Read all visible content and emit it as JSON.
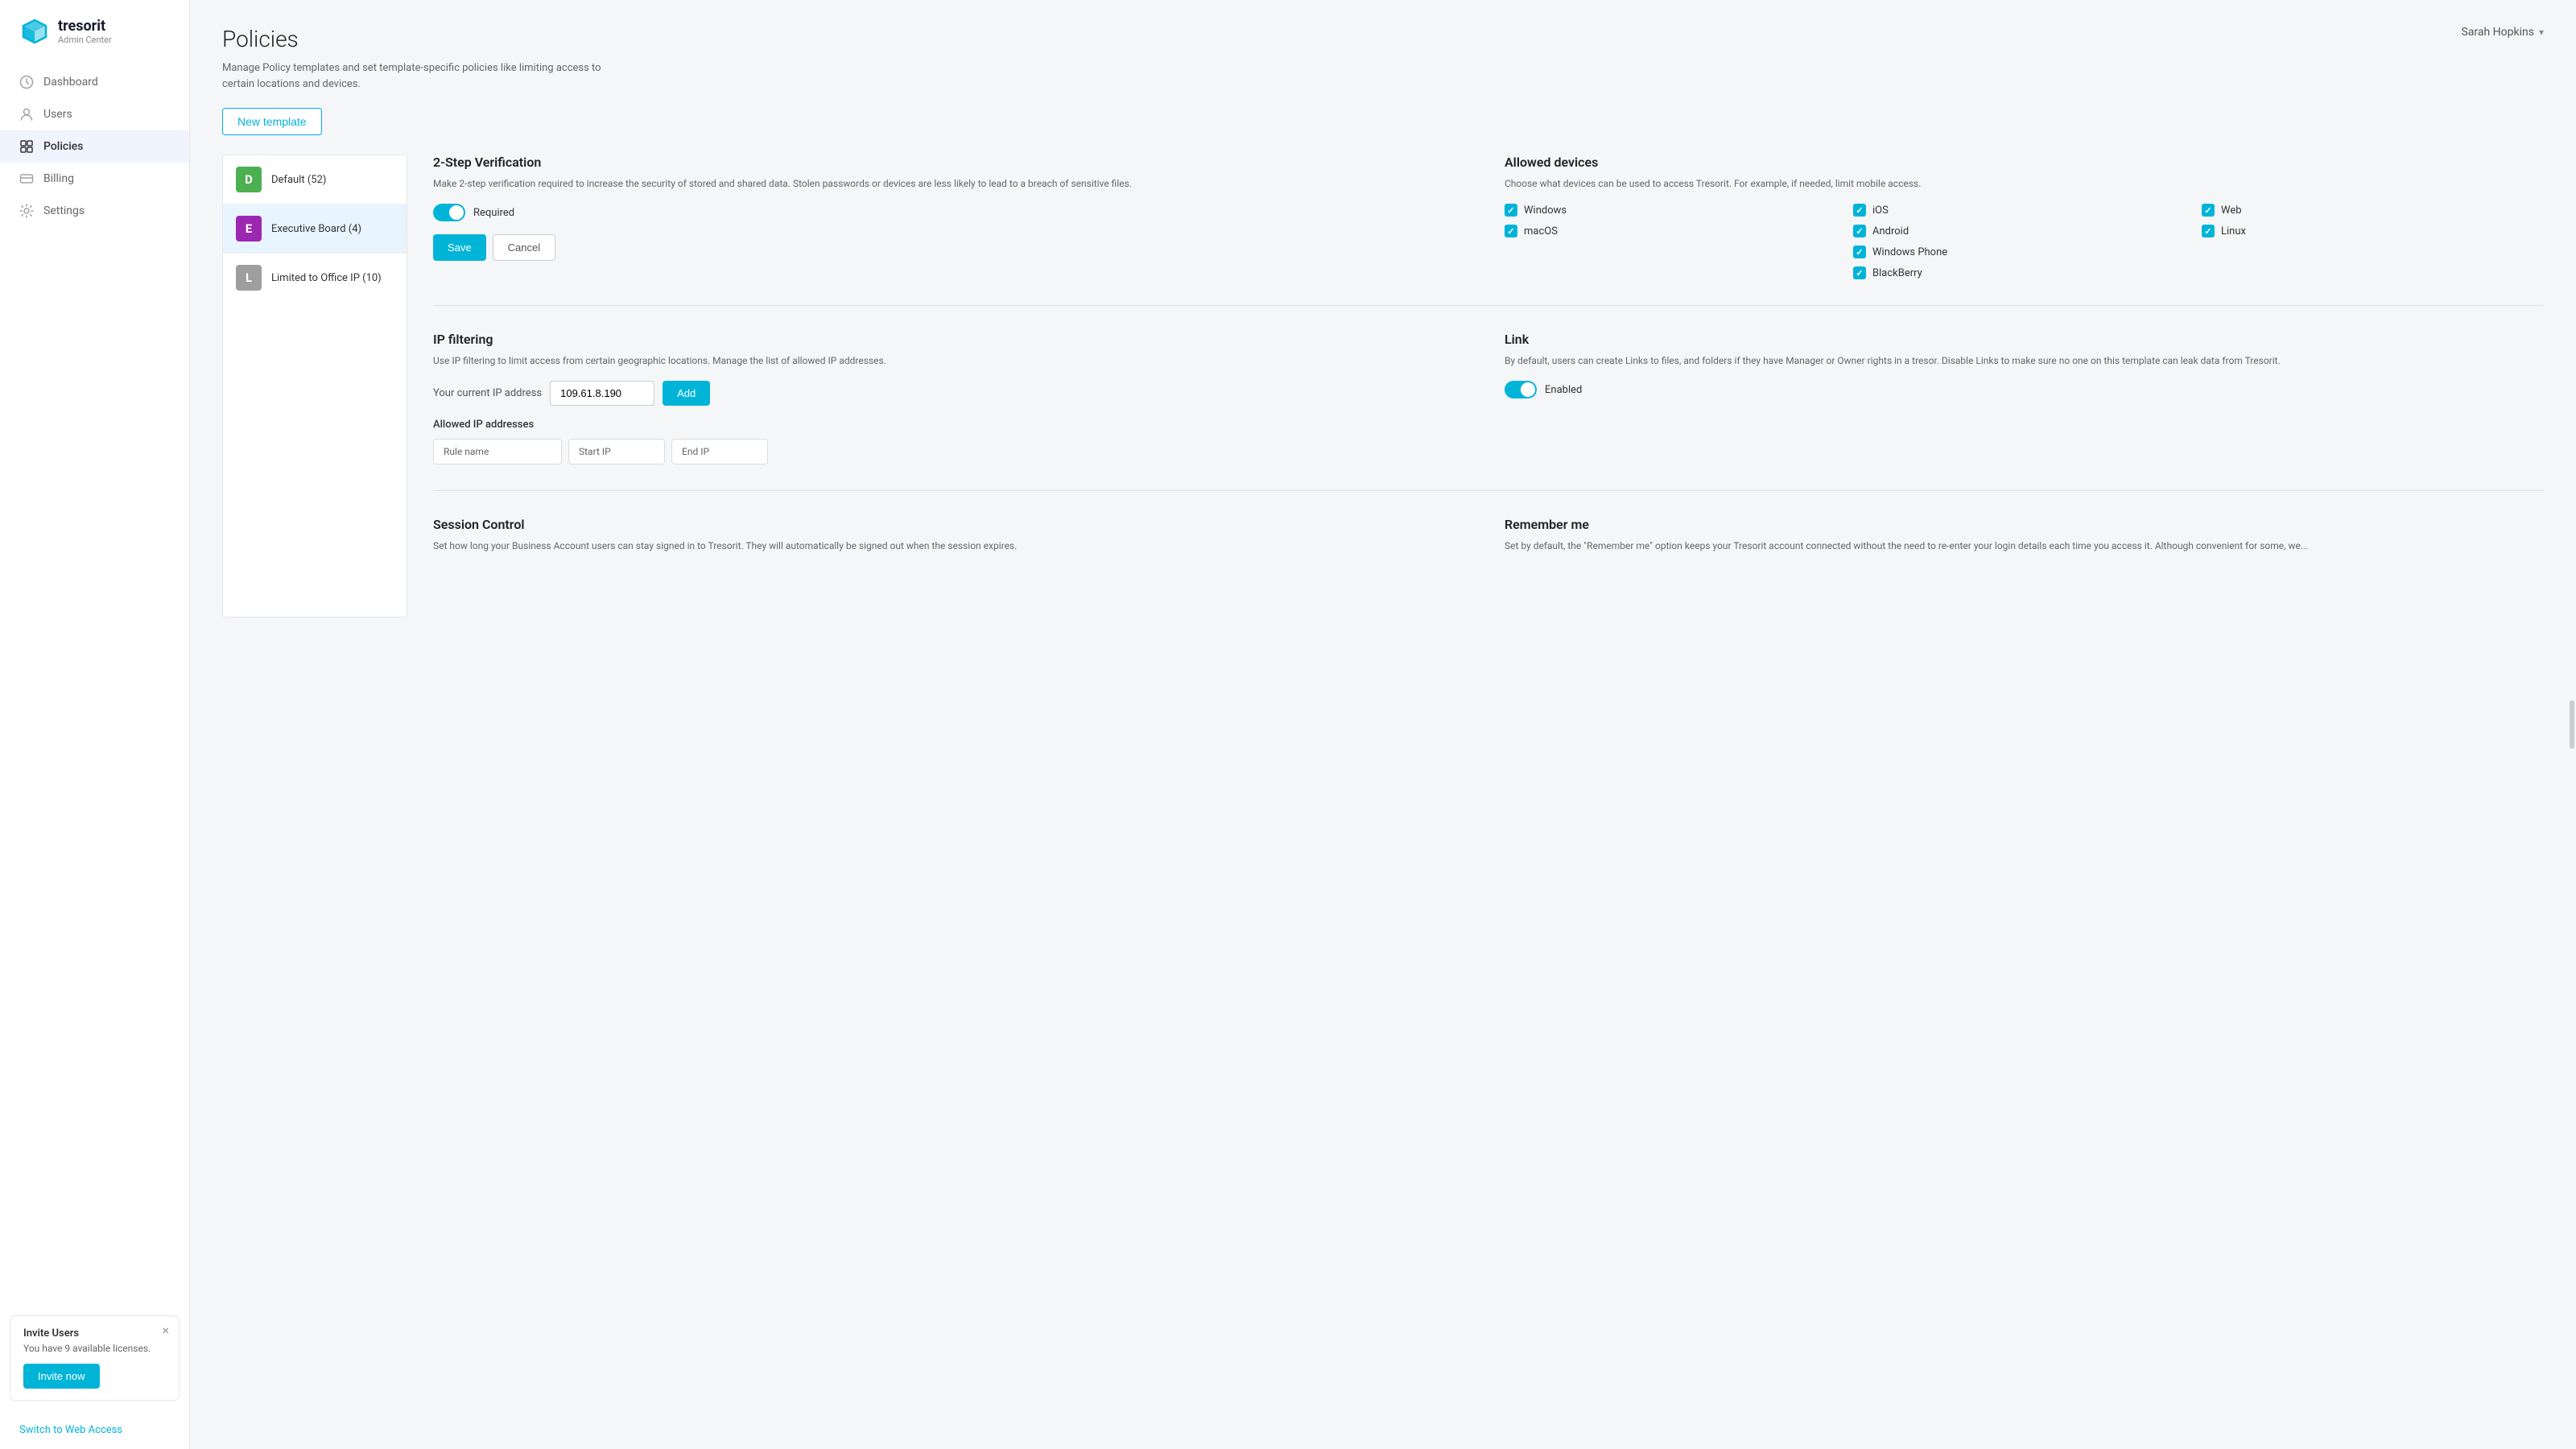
{
  "app": {
    "name": "tresorit",
    "admin_label": "Admin Center"
  },
  "user": {
    "name": "Sarah Hopkins"
  },
  "sidebar": {
    "nav_items": [
      {
        "id": "dashboard",
        "label": "Dashboard",
        "icon": "clock-icon",
        "active": false
      },
      {
        "id": "users",
        "label": "Users",
        "icon": "user-icon",
        "active": false
      },
      {
        "id": "policies",
        "label": "Policies",
        "icon": "grid-icon",
        "active": true
      },
      {
        "id": "billing",
        "label": "Billing",
        "icon": "card-icon",
        "active": false
      },
      {
        "id": "settings",
        "label": "Settings",
        "icon": "settings-icon",
        "active": false
      }
    ],
    "switch_web_access": "Switch to Web Access"
  },
  "invite_banner": {
    "title": "Invite Users",
    "description": "You have 9 available licenses.",
    "button_label": "Invite now"
  },
  "page": {
    "title": "Policies",
    "description": "Manage Policy templates and set template-specific policies like limiting access to certain locations and devices."
  },
  "new_template_button": "New template",
  "templates": [
    {
      "id": "default",
      "letter": "D",
      "name": "Default (52)",
      "color_class": "avatar-d"
    },
    {
      "id": "executive",
      "letter": "E",
      "name": "Executive Board (4)",
      "color_class": "avatar-e",
      "selected": true
    },
    {
      "id": "limited",
      "letter": "L",
      "name": "Limited to Office IP (10)",
      "color_class": "avatar-l"
    }
  ],
  "two_step": {
    "title": "2-Step Verification",
    "description": "Make 2-step verification required to increase the security of stored and shared data. Stolen passwords or devices are less likely to lead to a breach of sensitive files.",
    "toggle_label": "Required",
    "save_label": "Save",
    "cancel_label": "Cancel"
  },
  "allowed_devices": {
    "title": "Allowed devices",
    "description": "Choose what devices can be used to access Tresorit. For example, if needed, limit mobile access.",
    "devices": [
      {
        "label": "Windows",
        "checked": true
      },
      {
        "label": "iOS",
        "checked": true
      },
      {
        "label": "Web",
        "checked": true
      },
      {
        "label": "macOS",
        "checked": true
      },
      {
        "label": "Android",
        "checked": true
      },
      {
        "label": "Linux",
        "checked": true
      },
      {
        "label": "Windows Phone",
        "checked": true
      },
      {
        "label": "BlackBerry",
        "checked": true
      }
    ]
  },
  "ip_filtering": {
    "title": "IP filtering",
    "description": "Use IP filtering to limit access from certain geographic locations. Manage the list of allowed IP addresses.",
    "current_ip_label": "Your current IP address",
    "current_ip": "109.61.8.190",
    "add_label": "Add",
    "allowed_label": "Allowed IP addresses",
    "columns": [
      "Rule name",
      "Start IP",
      "End IP"
    ]
  },
  "link_section": {
    "title": "Link",
    "description": "By default, users can create Links to files, and folders if they have Manager or Owner rights in a tresor. Disable Links to make sure no one on this template can leak data from Tresorit.",
    "toggle_label": "Enabled"
  },
  "session_control": {
    "title": "Session Control",
    "description": "Set how long your Business Account users can stay signed in to Tresorit. They will automatically be signed out when the session expires."
  },
  "remember_me": {
    "title": "Remember me",
    "description": "Set by default, the \"Remember me\" option keeps your Tresorit account connected without the need to re-enter your login details each time you access it. Although convenient for some, we..."
  }
}
